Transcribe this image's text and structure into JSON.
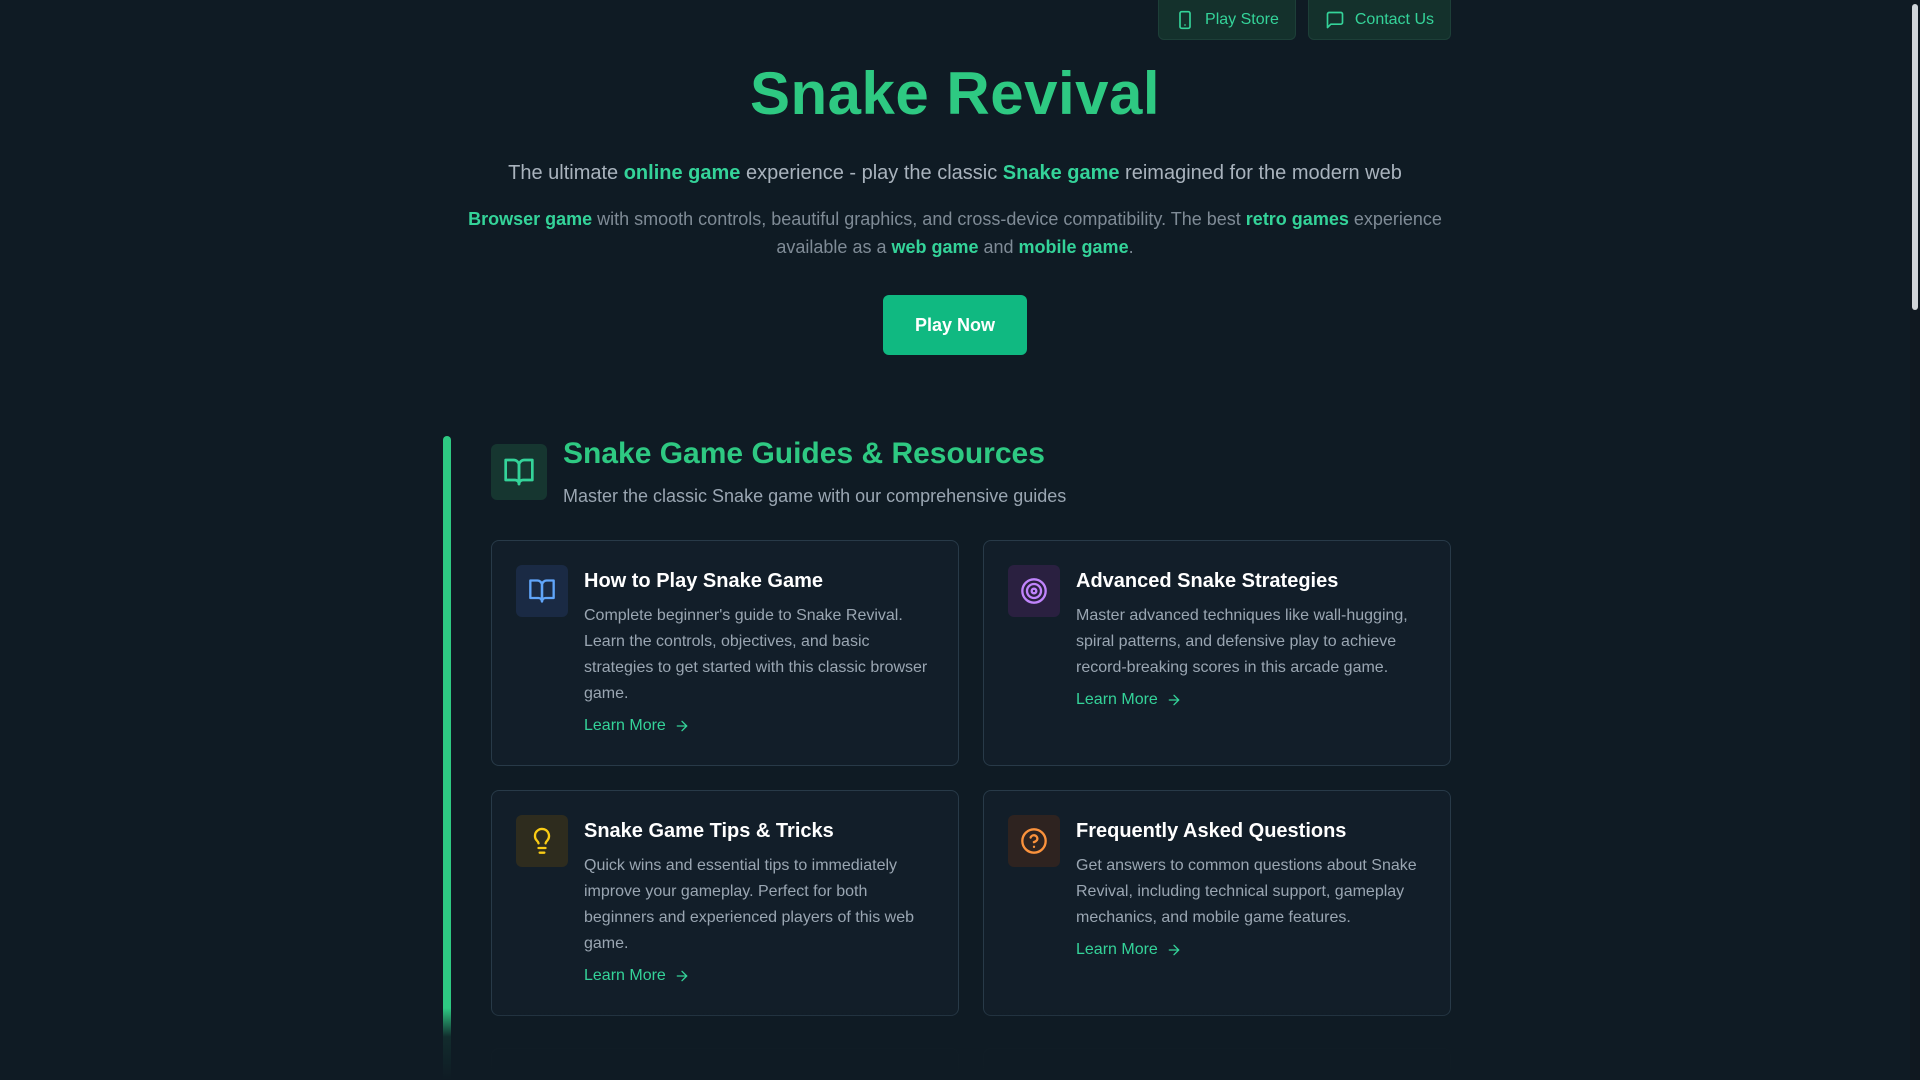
{
  "topbar": {
    "play_store": "Play Store",
    "contact_us": "Contact Us"
  },
  "hero": {
    "title": "Snake Revival",
    "subtitle": {
      "p1": "The ultimate ",
      "b1": "online game",
      "p2": " experience - play the classic ",
      "b2": "Snake game",
      "p3": " reimagined for the modern web"
    },
    "description": {
      "b1": "Browser game",
      "p1": " with smooth controls, beautiful graphics, and cross-device compatibility. The best ",
      "b2": "retro games",
      "p2": " experience available as a ",
      "b3": "web game",
      "p3": " and ",
      "b4": "mobile game",
      "p4": "."
    },
    "play_now": "Play Now"
  },
  "guides": {
    "title": "Snake Game Guides & Resources",
    "subtitle": "Master the classic Snake game with our comprehensive guides",
    "cards": [
      {
        "title": "How to Play Snake Game",
        "text": "Complete beginner's guide to Snake Revival. Learn the controls, objectives, and basic strategies to get started with this classic browser game.",
        "link": "Learn More",
        "icon": "book-icon",
        "color": "#60a5fa",
        "bg": "#1a2a44"
      },
      {
        "title": "Advanced Snake Strategies",
        "text": "Master advanced techniques like wall-hugging, spiral patterns, and defensive play to achieve record-breaking scores in this arcade game.",
        "link": "Learn More",
        "icon": "target-icon",
        "color": "#c084fc",
        "bg": "#2a2040"
      },
      {
        "title": "Snake Game Tips & Tricks",
        "text": "Quick wins and essential tips to immediately improve your gameplay. Perfect for both beginners and experienced players of this web game.",
        "link": "Learn More",
        "icon": "lightbulb-icon",
        "color": "#facc15",
        "bg": "#2e2c1e"
      },
      {
        "title": "Frequently Asked Questions",
        "text": "Get answers to common questions about Snake Revival, including technical support, gameplay mechanics, and mobile game features.",
        "link": "Learn More",
        "icon": "help-circle-icon",
        "color": "#fb923c",
        "bg": "#2e2320"
      }
    ]
  },
  "colors": {
    "accent": "#2ec982",
    "background": "#0f1b24",
    "button": "#10b981"
  }
}
